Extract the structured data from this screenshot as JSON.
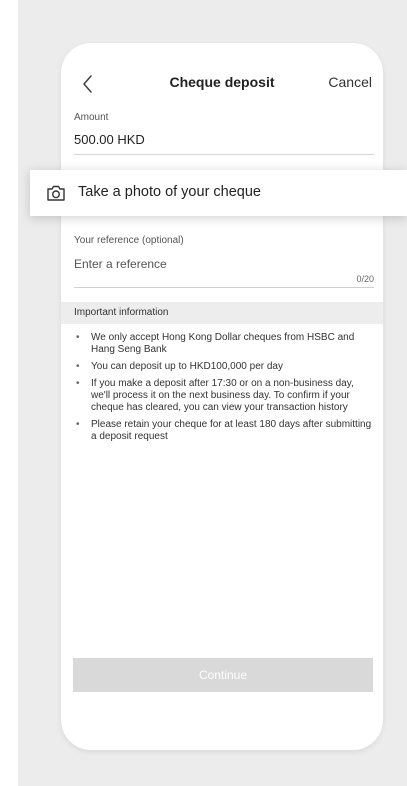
{
  "header": {
    "title": "Cheque deposit",
    "cancel_label": "Cancel"
  },
  "amount": {
    "label": "Amount",
    "value": "500.00 HKD"
  },
  "photo": {
    "label": "Take a photo of your cheque"
  },
  "reference": {
    "label": "Your reference (optional)",
    "placeholder": "Enter a reference",
    "counter": "0/20"
  },
  "info": {
    "title": "Important information",
    "items": [
      "We only accept Hong Kong Dollar cheques from HSBC and Hang Seng Bank",
      "You can deposit up to HKD100,000 per day",
      "If you make a deposit after 17:30 or on a non-business day, we'll process it on the next business day. To confirm if your cheque has cleared, you can view your transaction history",
      "Please retain your cheque for at least 180 days after submitting a deposit request"
    ]
  },
  "footer": {
    "continue_label": "Continue"
  },
  "icons": {
    "back": "chevron-left-icon",
    "camera": "camera-icon"
  },
  "colors": {
    "disabled_button": "#d9d9d9",
    "info_header": "#ededed",
    "backdrop": "#ececec"
  }
}
